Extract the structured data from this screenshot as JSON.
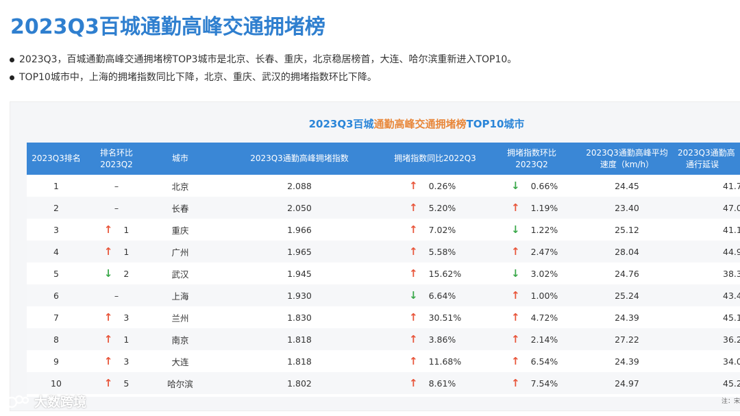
{
  "title": "2023Q3百城通勤高峰交通拥堵榜",
  "bullets": [
    "2023Q3，百城通勤高峰交通拥堵榜TOP3城市是北京、长春、重庆，北京稳居榜首，大连、哈尔滨重新进入TOP10。",
    "TOP10城市中，上海的拥堵指数同比下降，北京、重庆、武汉的拥堵指数环比下降。"
  ],
  "table_title": {
    "part1": "2023Q3百城",
    "part2": "通勤高峰交通拥堵榜",
    "part3": "TOP10城市"
  },
  "colors": {
    "title": "#2f7fcf",
    "header_bg": "#3a87d6",
    "up": "#e8553a",
    "down": "#3aa84a"
  },
  "headers": {
    "rank": "2023Q3排名",
    "rank_change_l1": "排名环比",
    "rank_change_l2": "2023Q2",
    "city": "城市",
    "index": "2023Q3通勤高峰拥堵指数",
    "yoy": "拥堵指数同比2022Q3",
    "qoq_l1": "拥堵指数环比",
    "qoq_l2": "2023Q2",
    "speed_l1": "2023Q3通勤高峰平均",
    "speed_l2": "速度（km/h）",
    "delay_l1": "2023Q3通勤高",
    "delay_l2": "通行延误"
  },
  "rows": [
    {
      "rank": "1",
      "rank_dir": "none",
      "rank_change": "–",
      "city": "北京",
      "index": "2.088",
      "yoy_dir": "up",
      "yoy": "0.26%",
      "qoq_dir": "down",
      "qoq": "0.66%",
      "speed": "24.45",
      "delay": "41.7"
    },
    {
      "rank": "2",
      "rank_dir": "none",
      "rank_change": "–",
      "city": "长春",
      "index": "2.050",
      "yoy_dir": "up",
      "yoy": "5.20%",
      "qoq_dir": "up",
      "qoq": "1.19%",
      "speed": "23.40",
      "delay": "47.0"
    },
    {
      "rank": "3",
      "rank_dir": "up",
      "rank_change": "1",
      "city": "重庆",
      "index": "1.966",
      "yoy_dir": "up",
      "yoy": "7.02%",
      "qoq_dir": "down",
      "qoq": "1.22%",
      "speed": "25.12",
      "delay": "41.1"
    },
    {
      "rank": "4",
      "rank_dir": "up",
      "rank_change": "1",
      "city": "广州",
      "index": "1.965",
      "yoy_dir": "up",
      "yoy": "5.58%",
      "qoq_dir": "up",
      "qoq": "2.47%",
      "speed": "28.04",
      "delay": "44.9"
    },
    {
      "rank": "5",
      "rank_dir": "down",
      "rank_change": "2",
      "city": "武汉",
      "index": "1.945",
      "yoy_dir": "up",
      "yoy": "15.62%",
      "qoq_dir": "down",
      "qoq": "3.02%",
      "speed": "24.76",
      "delay": "38.3"
    },
    {
      "rank": "6",
      "rank_dir": "none",
      "rank_change": "–",
      "city": "上海",
      "index": "1.930",
      "yoy_dir": "down",
      "yoy": "6.64%",
      "qoq_dir": "up",
      "qoq": "1.00%",
      "speed": "25.24",
      "delay": "43.4"
    },
    {
      "rank": "7",
      "rank_dir": "up",
      "rank_change": "3",
      "city": "兰州",
      "index": "1.830",
      "yoy_dir": "up",
      "yoy": "30.51%",
      "qoq_dir": "up",
      "qoq": "4.72%",
      "speed": "24.39",
      "delay": "45.1"
    },
    {
      "rank": "8",
      "rank_dir": "up",
      "rank_change": "1",
      "city": "南京",
      "index": "1.818",
      "yoy_dir": "up",
      "yoy": "3.86%",
      "qoq_dir": "up",
      "qoq": "2.14%",
      "speed": "27.22",
      "delay": "36.2"
    },
    {
      "rank": "9",
      "rank_dir": "up",
      "rank_change": "3",
      "city": "大连",
      "index": "1.818",
      "yoy_dir": "up",
      "yoy": "11.68%",
      "qoq_dir": "up",
      "qoq": "6.54%",
      "speed": "24.39",
      "delay": "34.0"
    },
    {
      "rank": "10",
      "rank_dir": "up",
      "rank_change": "5",
      "city": "哈尔滨",
      "index": "1.802",
      "yoy_dir": "up",
      "yoy": "8.61%",
      "qoq_dir": "up",
      "qoq": "7.54%",
      "speed": "24.97",
      "delay": "45.2"
    }
  ],
  "footnote": "注：宋",
  "watermark": "大数跨境"
}
